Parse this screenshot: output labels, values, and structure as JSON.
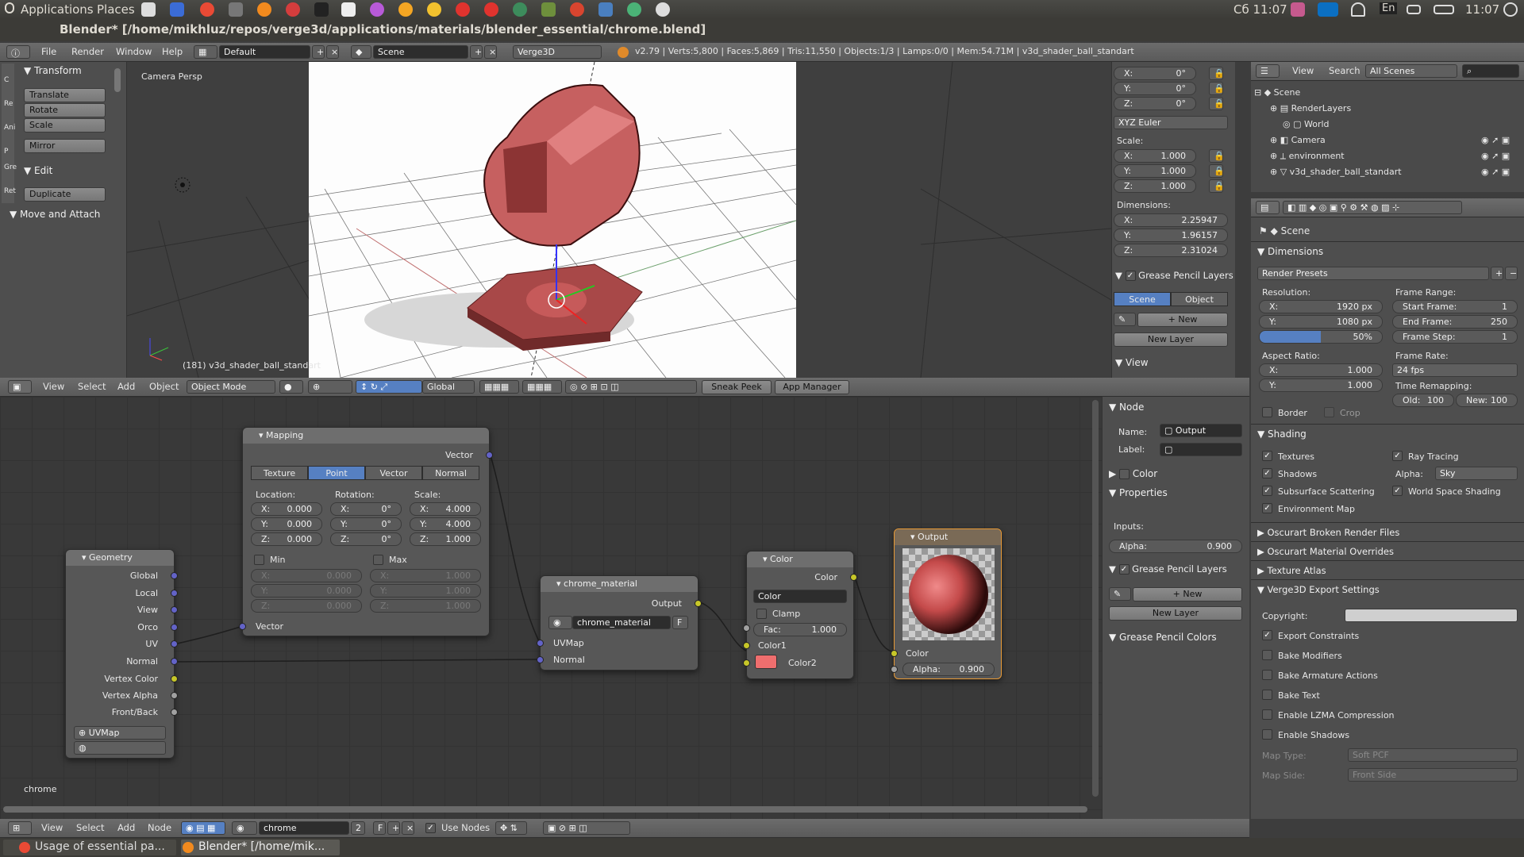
{
  "topbar": {
    "applications": "Applications",
    "places": "Places",
    "clock_left": "Сб 11:07",
    "keyboard": "En",
    "clock_right": "11:07"
  },
  "window_title": "Blender* [/home/mikhluz/repos/verge3d/applications/materials/blender_essential/chrome.blend]",
  "info_header": {
    "menus": [
      "File",
      "Render",
      "Window",
      "Help"
    ],
    "screen": "Default",
    "scene": "Scene",
    "engine": "Verge3D",
    "stats": "v2.79 | Verts:5,800 | Faces:5,869 | Tris:11,550 | Objects:1/3 | Lamps:0/0 | Mem:54.71M | v3d_shader_ball_standart"
  },
  "toolshelf": {
    "tabs": [
      "C",
      "Re",
      "Ani",
      "P",
      "Gre",
      "Ret"
    ],
    "transform": "Transform",
    "tools": [
      "Translate",
      "Rotate",
      "Scale"
    ],
    "mirror": "Mirror",
    "edit": "Edit",
    "duplicate": "Duplicate",
    "move_attach": "Move and Attach"
  },
  "viewport": {
    "label": "Camera Persp",
    "object_label": "(181) v3d_shader_ball_standart"
  },
  "n_panel": {
    "rotation": [
      {
        "axis": "X:",
        "value": "0°"
      },
      {
        "axis": "Y:",
        "value": "0°"
      },
      {
        "axis": "Z:",
        "value": "0°"
      }
    ],
    "rotation_mode": "XYZ Euler",
    "scale_label": "Scale:",
    "scale": [
      {
        "axis": "X:",
        "value": "1.000"
      },
      {
        "axis": "Y:",
        "value": "1.000"
      },
      {
        "axis": "Z:",
        "value": "1.000"
      }
    ],
    "dimensions_label": "Dimensions:",
    "dimensions": [
      {
        "axis": "X:",
        "value": "2.25947"
      },
      {
        "axis": "Y:",
        "value": "1.96157"
      },
      {
        "axis": "Z:",
        "value": "2.31024"
      }
    ],
    "grease_pencil": "Grease Pencil Layers",
    "gp_tabs": [
      "Scene",
      "Object"
    ],
    "new": "New",
    "new_layer": "New Layer",
    "view": "View"
  },
  "view3d_header": {
    "menus": [
      "View",
      "Select",
      "Add",
      "Object"
    ],
    "mode": "Object Mode",
    "orientation": "Global",
    "sneak_peek": "Sneak Peek",
    "app_manager": "App Manager"
  },
  "outliner": {
    "menus": [
      "View",
      "Search"
    ],
    "filter": "All Scenes",
    "items": [
      "Scene",
      "RenderLayers",
      "World",
      "Camera",
      "environment",
      "v3d_shader_ball_standart"
    ]
  },
  "properties": {
    "context": "Scene",
    "dimensions": "Dimensions",
    "render_presets": "Render Presets",
    "resolution": "Resolution:",
    "res_x": "1920 px",
    "res_y": "1080 px",
    "res_pct": "50%",
    "frame_range": "Frame Range:",
    "start_frame_label": "Start Frame:",
    "start_frame": "1",
    "end_frame_label": "End Frame:",
    "end_frame": "250",
    "frame_step_label": "Frame Step:",
    "frame_step": "1",
    "aspect": "Aspect Ratio:",
    "aspect_x": "1.000",
    "aspect_y": "1.000",
    "frame_rate": "Frame Rate:",
    "fps": "24 fps",
    "time_remap": "Time Remapping:",
    "old_label": "Old:",
    "old": "100",
    "new_label": "New:",
    "new": "100",
    "border": "Border",
    "crop": "Crop",
    "shading": "Shading",
    "textures": "Textures",
    "ray_tracing": "Ray Tracing",
    "shadows": "Shadows",
    "alpha_label": "Alpha:",
    "alpha": "Sky",
    "sss": "Subsurface Scattering",
    "world_space": "World Space Shading",
    "env_map": "Environment Map",
    "oscurart_broken": "Oscurart Broken Render Files",
    "oscurart_overrides": "Oscurart Material Overrides",
    "texture_atlas": "Texture Atlas",
    "v3d_export": "Verge3D Export Settings",
    "copyright": "Copyright:",
    "export_constraints": "Export Constraints",
    "bake_modifiers": "Bake Modifiers",
    "bake_armature": "Bake Armature Actions",
    "bake_text": "Bake Text",
    "lzma": "Enable LZMA Compression",
    "enable_shadows": "Enable Shadows",
    "map_type_label": "Map Type:",
    "map_type": "Soft PCF",
    "map_side_label": "Map Side:",
    "map_side": "Front Side"
  },
  "node_panel": {
    "node": "Node",
    "name_label": "Name:",
    "name": "Output",
    "label_label": "Label:",
    "color": "Color",
    "properties": "Properties",
    "inputs": "Inputs:",
    "alpha_label": "Alpha:",
    "alpha": "0.900",
    "grease_pencil": "Grease Pencil Layers",
    "new": "New",
    "new_layer": "New Layer",
    "gp_colors": "Grease Pencil Colors"
  },
  "nodes": {
    "mapping": {
      "title": "Mapping",
      "out": "Vector",
      "tabs": [
        "Texture",
        "Point",
        "Vector",
        "Normal"
      ],
      "location": "Location:",
      "rotation": "Rotation:",
      "scale": "Scale:",
      "loc": [
        {
          "a": "X:",
          "v": "0.000"
        },
        {
          "a": "Y:",
          "v": "0.000"
        },
        {
          "a": "Z:",
          "v": "0.000"
        }
      ],
      "rot": [
        {
          "a": "X:",
          "v": "0°"
        },
        {
          "a": "Y:",
          "v": "0°"
        },
        {
          "a": "Z:",
          "v": "0°"
        }
      ],
      "scl": [
        {
          "a": "X:",
          "v": "4.000"
        },
        {
          "a": "Y:",
          "v": "4.000"
        },
        {
          "a": "Z:",
          "v": "1.000"
        }
      ],
      "min": "Min",
      "max": "Max",
      "min_vals": [
        {
          "a": "X:",
          "v": "0.000"
        },
        {
          "a": "Y:",
          "v": "0.000"
        },
        {
          "a": "Z:",
          "v": "0.000"
        }
      ],
      "max_vals": [
        {
          "a": "X:",
          "v": "1.000"
        },
        {
          "a": "Y:",
          "v": "1.000"
        },
        {
          "a": "Z:",
          "v": "1.000"
        }
      ],
      "in": "Vector"
    },
    "geometry": {
      "title": "Geometry",
      "outputs": [
        "Global",
        "Local",
        "View",
        "Orco",
        "UV",
        "Normal",
        "Vertex Color",
        "Vertex Alpha",
        "Front/Back"
      ],
      "uvmap": "UVMap"
    },
    "chrome": {
      "title": "chrome_material",
      "out": "Output",
      "material": "chrome_material",
      "f": "F",
      "inputs": [
        "UVMap",
        "Normal"
      ]
    },
    "color": {
      "title": "Color",
      "out": "Color",
      "mode": "Color",
      "clamp": "Clamp",
      "fac_label": "Fac:",
      "fac": "1.000",
      "color1": "Color1",
      "color2": "Color2",
      "color2_value": "#ef6e6e"
    },
    "output": {
      "title": "Output",
      "color": "Color",
      "alpha_label": "Alpha:",
      "alpha": "0.900"
    }
  },
  "node_editor": {
    "tree_label": "chrome",
    "menus": [
      "View",
      "Select",
      "Add",
      "Node"
    ],
    "material": "chrome",
    "users": "2",
    "f": "F",
    "use_nodes": "Use Nodes"
  },
  "taskbar": {
    "items": [
      "Usage of essential pa...",
      "Blender* [/home/mik..."
    ]
  }
}
